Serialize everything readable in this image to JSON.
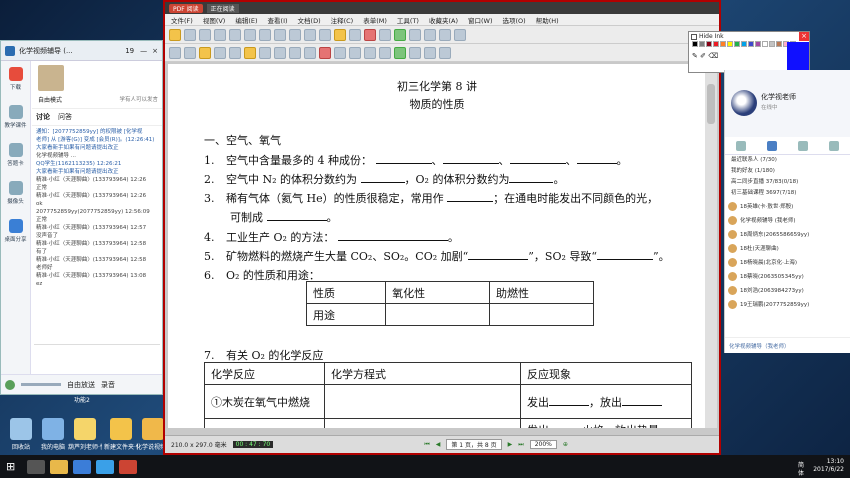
{
  "desktop": {
    "icons": [
      {
        "label": "回收站",
        "color": "#9cc5e8"
      },
      {
        "label": "我的电脑",
        "color": "#7fb2e5"
      },
      {
        "label": "葫芦刘老师·快捷方式",
        "color": "#f5d56a"
      },
      {
        "label": "新建文件夹·快捷方式",
        "color": "#f3c34a"
      },
      {
        "label": "化学说视频·快捷方式",
        "color": "#f0b84a"
      }
    ]
  },
  "qq": {
    "title": "化学视频辅导 (...",
    "count": "19",
    "avatar_label": "自由模式",
    "mode_hint": "学有人可以发言",
    "tabs": [
      "讨论",
      "问答"
    ],
    "sidebar": [
      {
        "label": "下载",
        "icon": "download-icon"
      },
      {
        "label": "教学课件",
        "icon": "courseware-icon"
      },
      {
        "label": "答题卡",
        "icon": "answer-card-icon"
      },
      {
        "label": "摄像头",
        "icon": "camera-icon"
      },
      {
        "label": "桌面分享",
        "icon": "screen-share-icon"
      }
    ],
    "messages": [
      {
        "text": "通知：[2077752859yy] 的权限被 [化学视",
        "sys": true
      },
      {
        "text": "老师] 从 [游客(G)] 变成 [会员(R)]。(12:26:41)",
        "sys": true
      },
      {
        "text": "大家看新手如果有问题请提出改正",
        "sys": true
      },
      {
        "text": "化学视频辅导 ...",
        "sys": false
      },
      {
        "text": "QQ学生(1162113235) 12:26:21",
        "sys": true
      },
      {
        "text": "大家看新手如果有问题请提出改正",
        "sys": true
      },
      {
        "text": "精准·小红〈天涯聊曲〉(133793964) 12:26",
        "sys": false
      },
      {
        "text": "正常",
        "sys": false
      },
      {
        "text": "精准·小红〈天涯聊曲〉(133793964) 12:26",
        "sys": false
      },
      {
        "text": "ok",
        "sys": false
      },
      {
        "text": "2077752859yy(2077752859yy) 12:56:09",
        "sys": false
      },
      {
        "text": "正常",
        "sys": false
      },
      {
        "text": "精准·小红〈天涯聊曲〉(133793964) 12:57",
        "sys": false
      },
      {
        "text": "没声音了",
        "sys": false
      },
      {
        "text": "精准·小红〈天涯聊曲〉(133793964) 12:58",
        "sys": false
      },
      {
        "text": "有了",
        "sys": false
      },
      {
        "text": "精准·小红〈天涯聊曲〉(133793964) 12:58",
        "sys": false
      },
      {
        "text": "老师好",
        "sys": false
      },
      {
        "text": "精准·小红〈天涯聊曲〉(133793964) 13:08",
        "sys": false
      },
      {
        "text": "ez",
        "sys": false
      }
    ],
    "bottom": {
      "share": "自由放送",
      "record": "录音",
      "version": "功能2"
    }
  },
  "pdf": {
    "app_tab": "PDF 阅读",
    "title_tab": "正在阅读",
    "menu": [
      "文件(F)",
      "视图(V)",
      "编辑(E)",
      "查看(I)",
      "文档(D)",
      "注释(C)",
      "表单(M)",
      "工具(T)",
      "收藏夹(A)",
      "窗口(W)",
      "选项(O)",
      "帮助(H)"
    ],
    "status": {
      "size": "210.0 x 297.0 毫米",
      "page": "第 1 页，共 8 页",
      "zoom": "200%",
      "timer": "00 : 47 : 70"
    },
    "doc": {
      "title1": "初三化学第 8 讲",
      "title2": "物质的性质",
      "section1": "一、空气、氧气",
      "items": [
        {
          "num": "1.",
          "text": "空气中含量最多的 4 种成份："
        },
        {
          "num": "2.",
          "text": "空气中 N₂ 的体积分数约为",
          "mid": "，O₂ 的体积分数约为"
        },
        {
          "num": "3.",
          "text": "稀有气体（氦气 He）的性质很稳定，常用作",
          "mid": "；在通电时能发出不同颜色的光，"
        },
        {
          "num": "",
          "text": "可制成"
        },
        {
          "num": "4.",
          "text": "工业生产 O₂ 的方法："
        },
        {
          "num": "5.",
          "text": "矿物燃料的燃烧产生大量 CO₂、SO₂。CO₂ 加剧“",
          "mid": "”，SO₂ 导致“",
          "end": "”。"
        },
        {
          "num": "6.",
          "text": "O₂ 的性质和用途："
        }
      ],
      "table1": {
        "row1": [
          "性质",
          "氧化性",
          "助燃性"
        ],
        "row2": [
          "用途",
          "",
          ""
        ]
      },
      "item7": {
        "num": "7.",
        "text": "有关 O₂ 的化学反应"
      },
      "table2": {
        "headers": [
          "化学反应",
          "化学方程式",
          "反应现象"
        ],
        "row1": {
          "reaction": "①木炭在氧气中燃烧",
          "phenomenon": "发出",
          "phenomenon_mid": "，放出"
        },
        "row2_partial": "发出______火焰，放出热量"
      }
    }
  },
  "ink": {
    "title": "Hide Ink",
    "close": "×",
    "colors": [
      "#000000",
      "#7f7f7f",
      "#880015",
      "#ed1c24",
      "#ff7f27",
      "#fff200",
      "#22b14c",
      "#00a2e8",
      "#3f48cc",
      "#a349a4",
      "#ffffff",
      "#c3c3c3",
      "#b97a57",
      "#ffaec9",
      "#ffc90e"
    ]
  },
  "contacts": {
    "name": "化学视老师",
    "status": "在线中",
    "groups": [
      "最近联系人 (7/30)",
      "我的好友 (1/180)",
      "高二同步直播 37/83(0/18)",
      "初三基础课程 3697(7/18)"
    ],
    "list": [
      "18英雄(卡·敖世·郑殷)",
      "化学视频辅导 (我老师)",
      "18周炳东(2065586659yy)",
      "18杜(天涯聊曲)",
      "18杨晓晨(北京化·上海)",
      "18蔡晓(2063505345yy)",
      "18刘浩(2063984273yy)",
      "19王瑞鹏(2077752859yy)"
    ],
    "footer": [
      "化学视频辅导（我老师）"
    ]
  },
  "taskbar": {
    "time": "13:10",
    "date": "2017/6/22",
    "ime": "简体"
  }
}
